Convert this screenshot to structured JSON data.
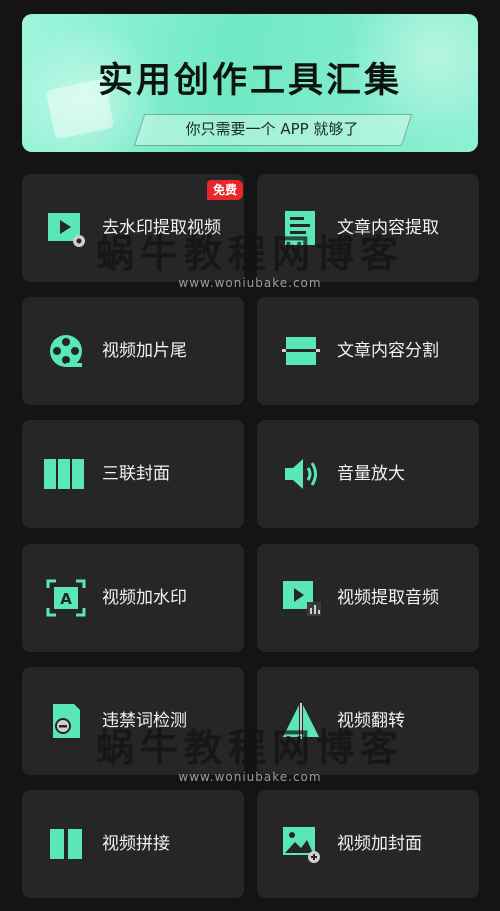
{
  "banner": {
    "title": "实用创作工具汇集",
    "subtitle": "你只需要一个 APP 就够了"
  },
  "badge": "免费",
  "accent_color": "#59e7b9",
  "tools": [
    {
      "label": "去水印提取视频",
      "icon": "video-play-icon"
    },
    {
      "label": "文章内容提取",
      "icon": "text-extract-icon"
    },
    {
      "label": "视频加片尾",
      "icon": "film-reel-icon"
    },
    {
      "label": "文章内容分割",
      "icon": "split-icon"
    },
    {
      "label": "三联封面",
      "icon": "triptych-icon"
    },
    {
      "label": "音量放大",
      "icon": "speaker-icon"
    },
    {
      "label": "视频加水印",
      "icon": "watermark-icon"
    },
    {
      "label": "视频提取音频",
      "icon": "audio-extract-icon"
    },
    {
      "label": "违禁词检测",
      "icon": "word-check-icon"
    },
    {
      "label": "视频翻转",
      "icon": "flip-icon"
    },
    {
      "label": "视频拼接",
      "icon": "splice-icon"
    },
    {
      "label": "视频加封面",
      "icon": "add-cover-icon"
    }
  ],
  "watermark": {
    "text": "蜗牛教程网博客",
    "url": "www.woniubake.com"
  }
}
